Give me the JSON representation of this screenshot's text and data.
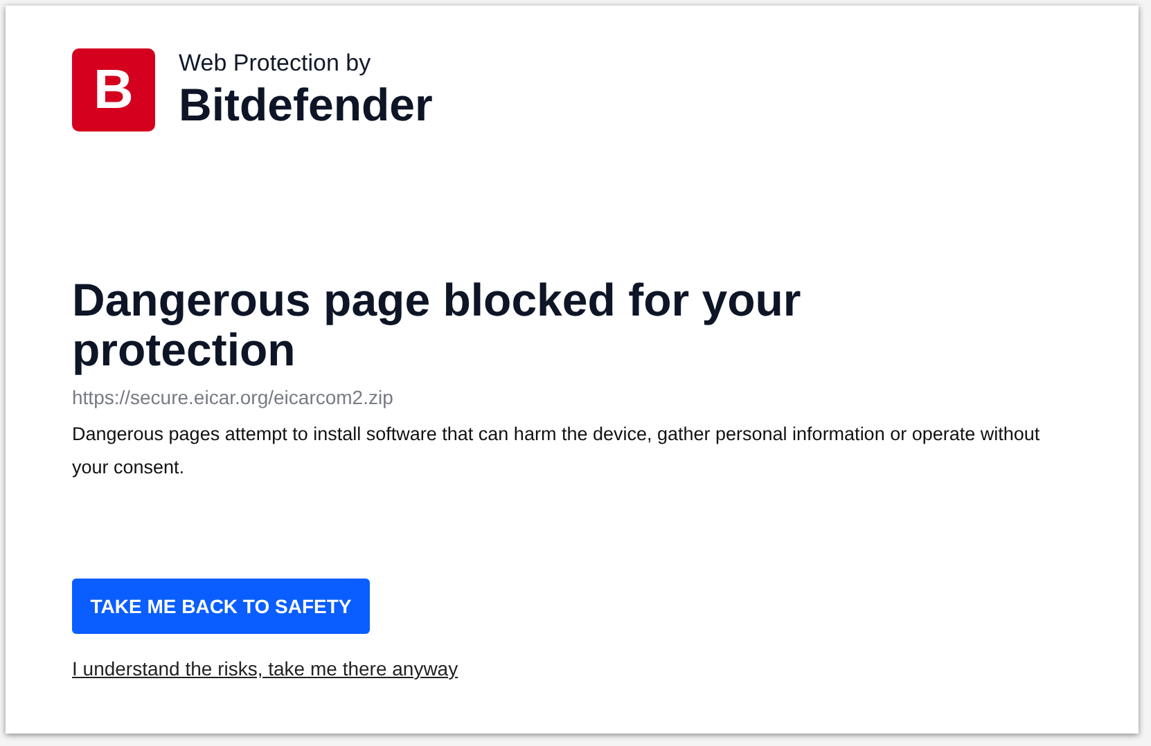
{
  "brand": {
    "logo_letter": "B",
    "tagline": "Web Protection by",
    "name": "Bitdefender"
  },
  "heading": "Dangerous page blocked for your protection",
  "url": "https://secure.eicar.org/eicarcom2.zip",
  "description": "Dangerous pages attempt to install software that can harm the device, gather personal information or operate without your consent.",
  "primary_button": "TAKE ME BACK TO SAFETY",
  "proceed_link": "I understand the risks, take me there anyway"
}
